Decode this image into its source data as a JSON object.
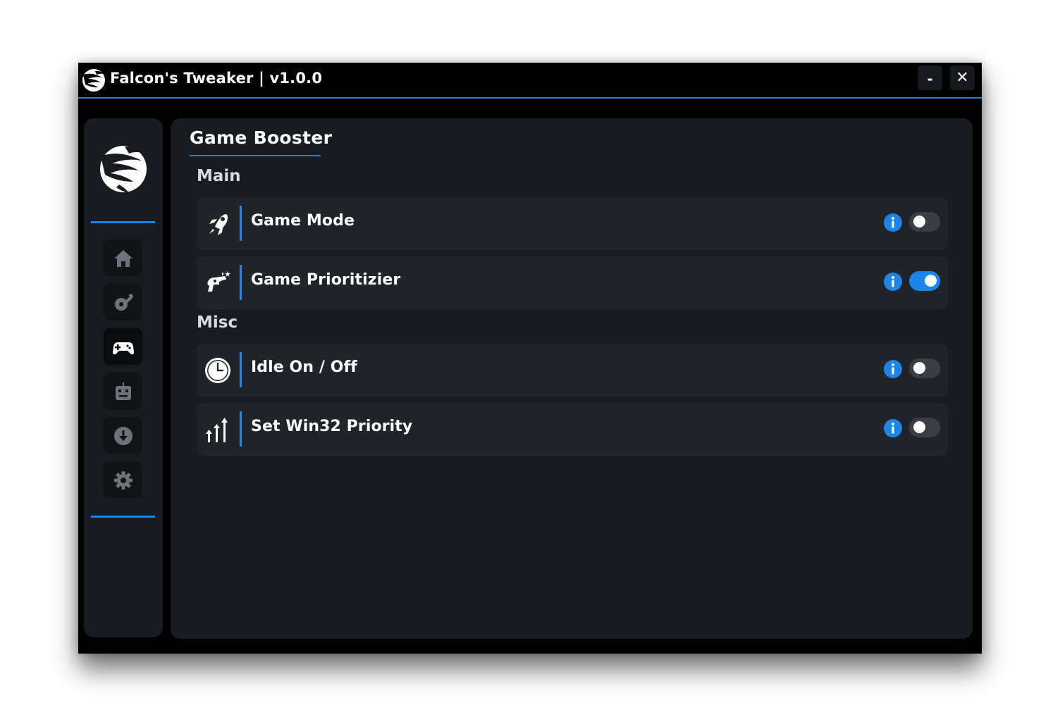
{
  "window": {
    "title": "Falcon's Tweaker | v1.0.0",
    "minimize_label": "-",
    "close_label": "✕"
  },
  "colors": {
    "accent": "#1b84e7",
    "window_bg": "#000000",
    "panel_bg": "#181b1f",
    "row_bg": "#212429",
    "toggle_off": "#3a3d43"
  },
  "sidebar": {
    "items": [
      {
        "icon": "home-icon",
        "active": false
      },
      {
        "icon": "tools-icon",
        "active": false
      },
      {
        "icon": "gamepad-icon",
        "active": true
      },
      {
        "icon": "robot-icon",
        "active": false
      },
      {
        "icon": "download-icon",
        "active": false
      },
      {
        "icon": "gear-icon",
        "active": false
      }
    ]
  },
  "main": {
    "page_title": "Game Booster",
    "sections": [
      {
        "label": "Main",
        "items": [
          {
            "label": "Game Mode",
            "icon": "rocket-icon",
            "enabled": false
          },
          {
            "label": "Game Prioritizier",
            "icon": "ray-gun-icon",
            "enabled": true
          }
        ]
      },
      {
        "label": "Misc",
        "items": [
          {
            "label": "Idle On / Off",
            "icon": "clock-icon",
            "enabled": false
          },
          {
            "label": "Set Win32 Priority",
            "icon": "priority-arrows-icon",
            "enabled": false
          }
        ]
      }
    ]
  }
}
